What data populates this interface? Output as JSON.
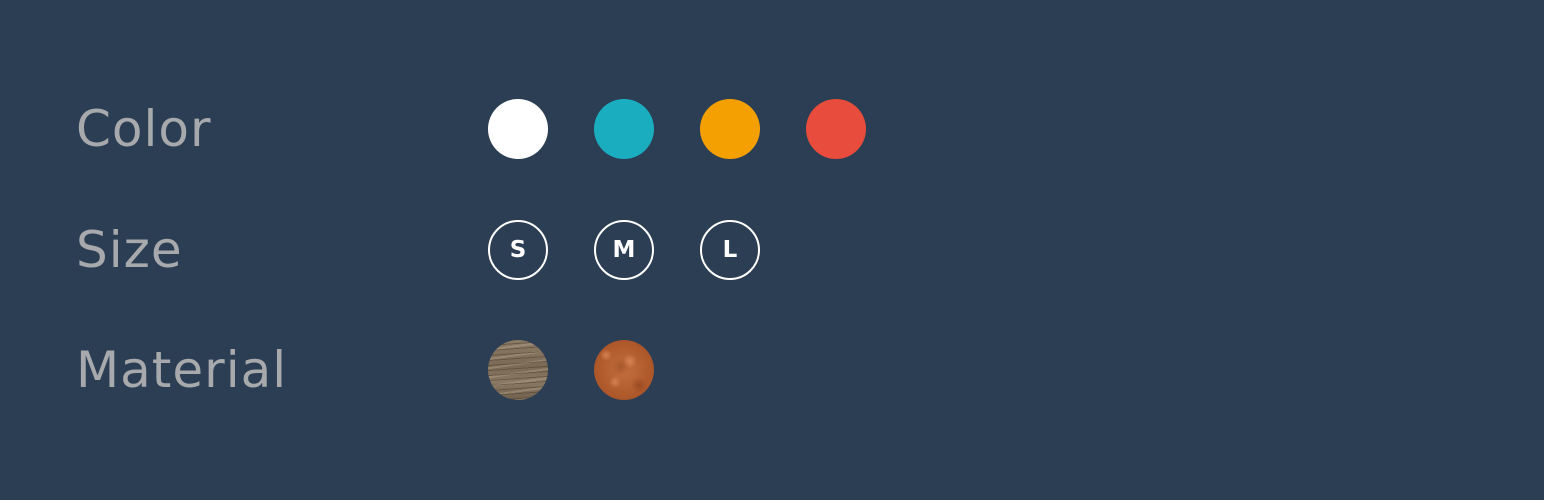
{
  "options": {
    "color": {
      "label": "Color",
      "swatches": [
        {
          "name": "white",
          "hex": "#ffffff"
        },
        {
          "name": "teal",
          "hex": "#1aadc0"
        },
        {
          "name": "orange",
          "hex": "#f4a003"
        },
        {
          "name": "red",
          "hex": "#e74c3c"
        }
      ]
    },
    "size": {
      "label": "Size",
      "swatches": [
        {
          "label": "S"
        },
        {
          "label": "M"
        },
        {
          "label": "L"
        }
      ]
    },
    "material": {
      "label": "Material",
      "swatches": [
        {
          "name": "wood"
        },
        {
          "name": "leather"
        }
      ]
    }
  },
  "theme": {
    "background": "#2c3e54",
    "label_color": "#a7a9ac"
  }
}
